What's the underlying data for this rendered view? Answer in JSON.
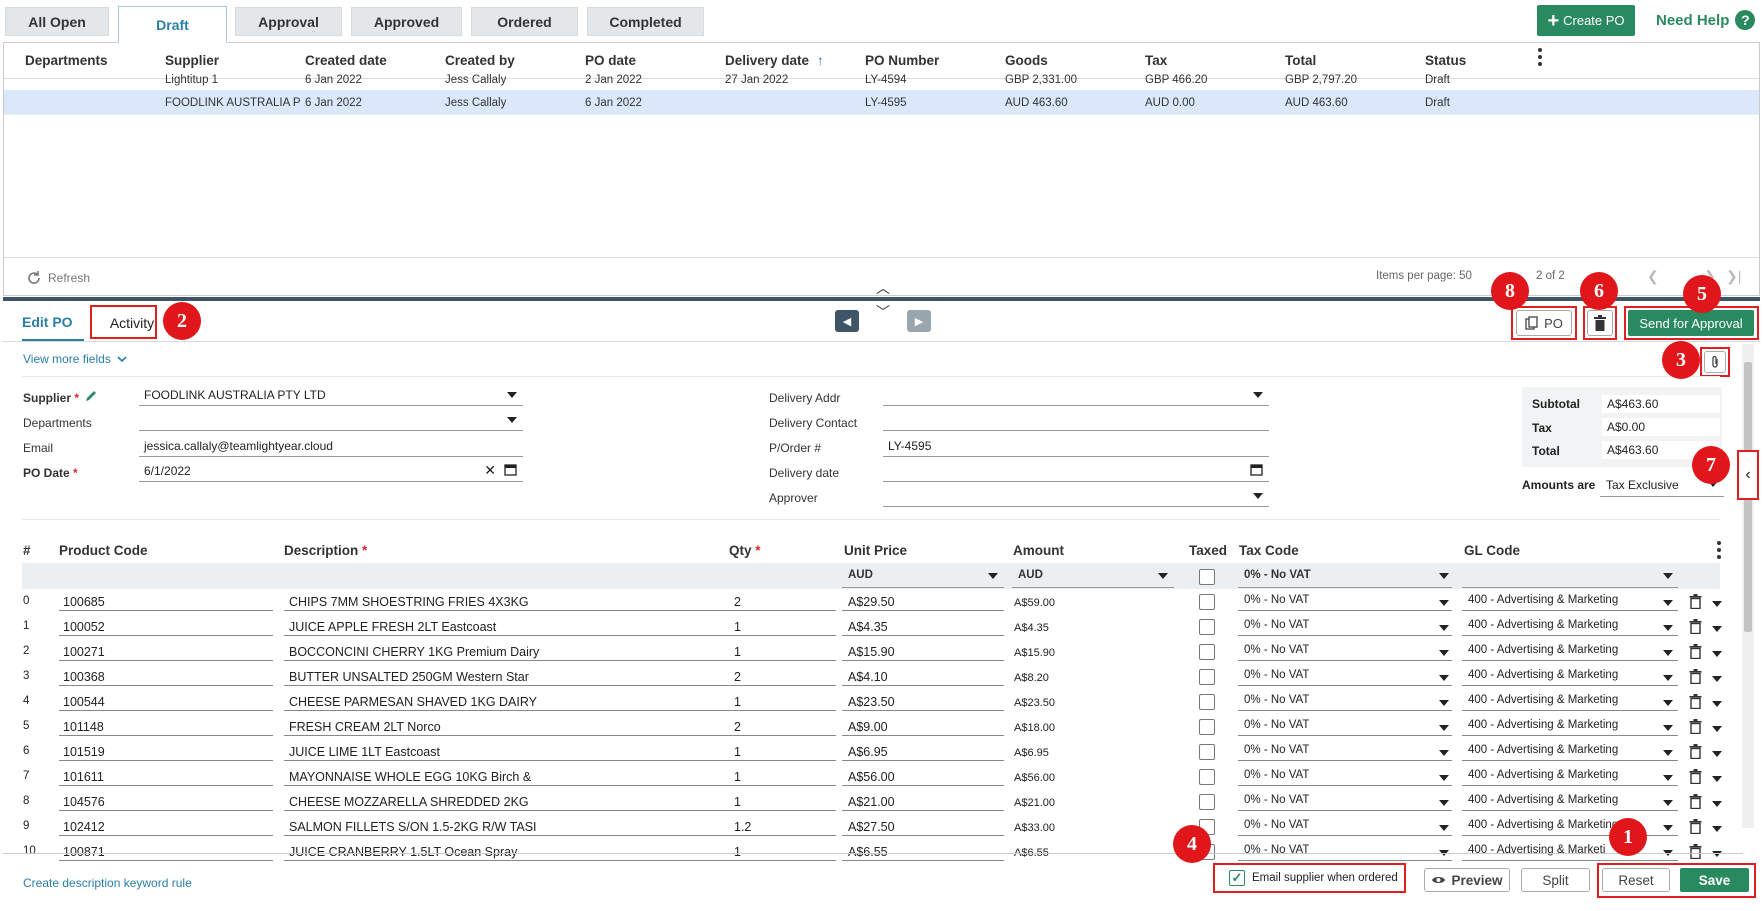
{
  "tabs": [
    "All Open",
    "Draft",
    "Approval",
    "Approved",
    "Ordered",
    "Completed"
  ],
  "header": {
    "create_label": "Create PO",
    "need_help": "Need Help",
    "help_glyph": "?"
  },
  "grid": {
    "columns": [
      "Departments",
      "Supplier",
      "Created date",
      "Created by",
      "PO date",
      "Delivery date",
      "PO Number",
      "Goods",
      "Tax",
      "Total",
      "Status"
    ],
    "sort_arrow": "↑",
    "rows": [
      [
        "",
        "Lightitup 1",
        "6 Jan 2022",
        "Jess Callaly",
        "2 Jan 2022",
        "27 Jan 2022",
        "LY-4594",
        "GBP 2,331.00",
        "GBP 466.20",
        "GBP 2,797.20",
        "Draft"
      ],
      [
        "",
        "FOODLINK AUSTRALIA PT...",
        "6 Jan 2022",
        "Jess Callaly",
        "6 Jan 2022",
        "",
        "LY-4595",
        "AUD 463.60",
        "AUD 0.00",
        "AUD 463.60",
        "Draft"
      ]
    ],
    "refresh_label": "Refresh",
    "items_per_page": "Items per page: 50",
    "pager_text": "2 of 2"
  },
  "edit": {
    "tab_edit": "Edit PO",
    "tab_activity": "Activity",
    "po_label": "PO",
    "send_label": "Send for Approval",
    "view_more": "View more fields",
    "supplier_label": "Supplier",
    "supplier_value": "FOODLINK AUSTRALIA PTY LTD",
    "departments_label": "Departments",
    "departments_value": "",
    "email_label": "Email",
    "email_value": "jessica.callaly@teamlightyear.cloud",
    "po_date_label": "PO Date",
    "po_date_value": "6/1/2022",
    "delivery_addr_label": "Delivery Addr",
    "delivery_contact_label": "Delivery Contact",
    "porder_label": "P/Order #",
    "porder_value": "LY-4595",
    "delivery_date_label": "Delivery date",
    "approver_label": "Approver",
    "subtotal_label": "Subtotal",
    "subtotal_value": "A$463.60",
    "tax_label": "Tax",
    "tax_value": "A$0.00",
    "total_label": "Total",
    "total_value": "A$463.60",
    "amounts_label": "Amounts are",
    "amounts_value": "Tax Exclusive",
    "required_star": "*"
  },
  "products": {
    "columns": [
      "#",
      "Product Code",
      "Description",
      "Qty",
      "Unit Price",
      "Amount",
      "Taxed",
      "Tax Code",
      "GL Code"
    ],
    "filter": {
      "unit_currency": "AUD",
      "amount_currency": "AUD",
      "tax_code": "0% - No VAT"
    },
    "rows": [
      [
        "0",
        "100685",
        "CHIPS 7MM SHOESTRING FRIES 4X3KG",
        "2",
        "A$29.50",
        "A$59.00",
        "0% - No VAT",
        "400 - Advertising & Marketing"
      ],
      [
        "1",
        "100052",
        "JUICE APPLE FRESH 2LT Eastcoast",
        "1",
        "A$4.35",
        "A$4.35",
        "0% - No VAT",
        "400 - Advertising & Marketing"
      ],
      [
        "2",
        "100271",
        "BOCCONCINI CHERRY 1KG Premium Dairy",
        "1",
        "A$15.90",
        "A$15.90",
        "0% - No VAT",
        "400 - Advertising & Marketing"
      ],
      [
        "3",
        "100368",
        "BUTTER UNSALTED 250GM Western Star",
        "2",
        "A$4.10",
        "A$8.20",
        "0% - No VAT",
        "400 - Advertising & Marketing"
      ],
      [
        "4",
        "100544",
        "CHEESE PARMESAN SHAVED 1KG DAIRY",
        "1",
        "A$23.50",
        "A$23.50",
        "0% - No VAT",
        "400 - Advertising & Marketing"
      ],
      [
        "5",
        "101148",
        "FRESH CREAM 2LT Norco",
        "2",
        "A$9.00",
        "A$18.00",
        "0% - No VAT",
        "400 - Advertising & Marketing"
      ],
      [
        "6",
        "101519",
        "JUICE LIME 1LT Eastcoast",
        "1",
        "A$6.95",
        "A$6.95",
        "0% - No VAT",
        "400 - Advertising & Marketing"
      ],
      [
        "7",
        "101611",
        "MAYONNAISE WHOLE EGG 10KG Birch &",
        "1",
        "A$56.00",
        "A$56.00",
        "0% - No VAT",
        "400 - Advertising & Marketing"
      ],
      [
        "8",
        "104576",
        "CHEESE MOZZARELLA SHREDDED 2KG",
        "1",
        "A$21.00",
        "A$21.00",
        "0% - No VAT",
        "400 - Advertising & Marketing"
      ],
      [
        "9",
        "102412",
        "SALMON FILLETS S/ON 1.5-2KG R/W TASI",
        "1.2",
        "A$27.50",
        "A$33.00",
        "0% - No VAT",
        "400 - Advertising & Marketing"
      ],
      [
        "10",
        "100871",
        "JUICE CRANBERRY 1.5LT Ocean Spray",
        "1",
        "A$6.55",
        "A$6.55",
        "0% - No VAT",
        "400 - Advertising & Marketi"
      ]
    ]
  },
  "bottom": {
    "desc_rule": "Create description keyword rule",
    "email_supplier": "Email supplier when ordered",
    "preview": "Preview",
    "split": "Split",
    "reset": "Reset",
    "save": "Save"
  },
  "annotations": [
    "1",
    "2",
    "3",
    "4",
    "5",
    "6",
    "7",
    "8"
  ],
  "colors": {
    "brand_green": "#2a8a5f",
    "accent_blue": "#2a7fa8",
    "annotation_red": "#e0161b"
  }
}
